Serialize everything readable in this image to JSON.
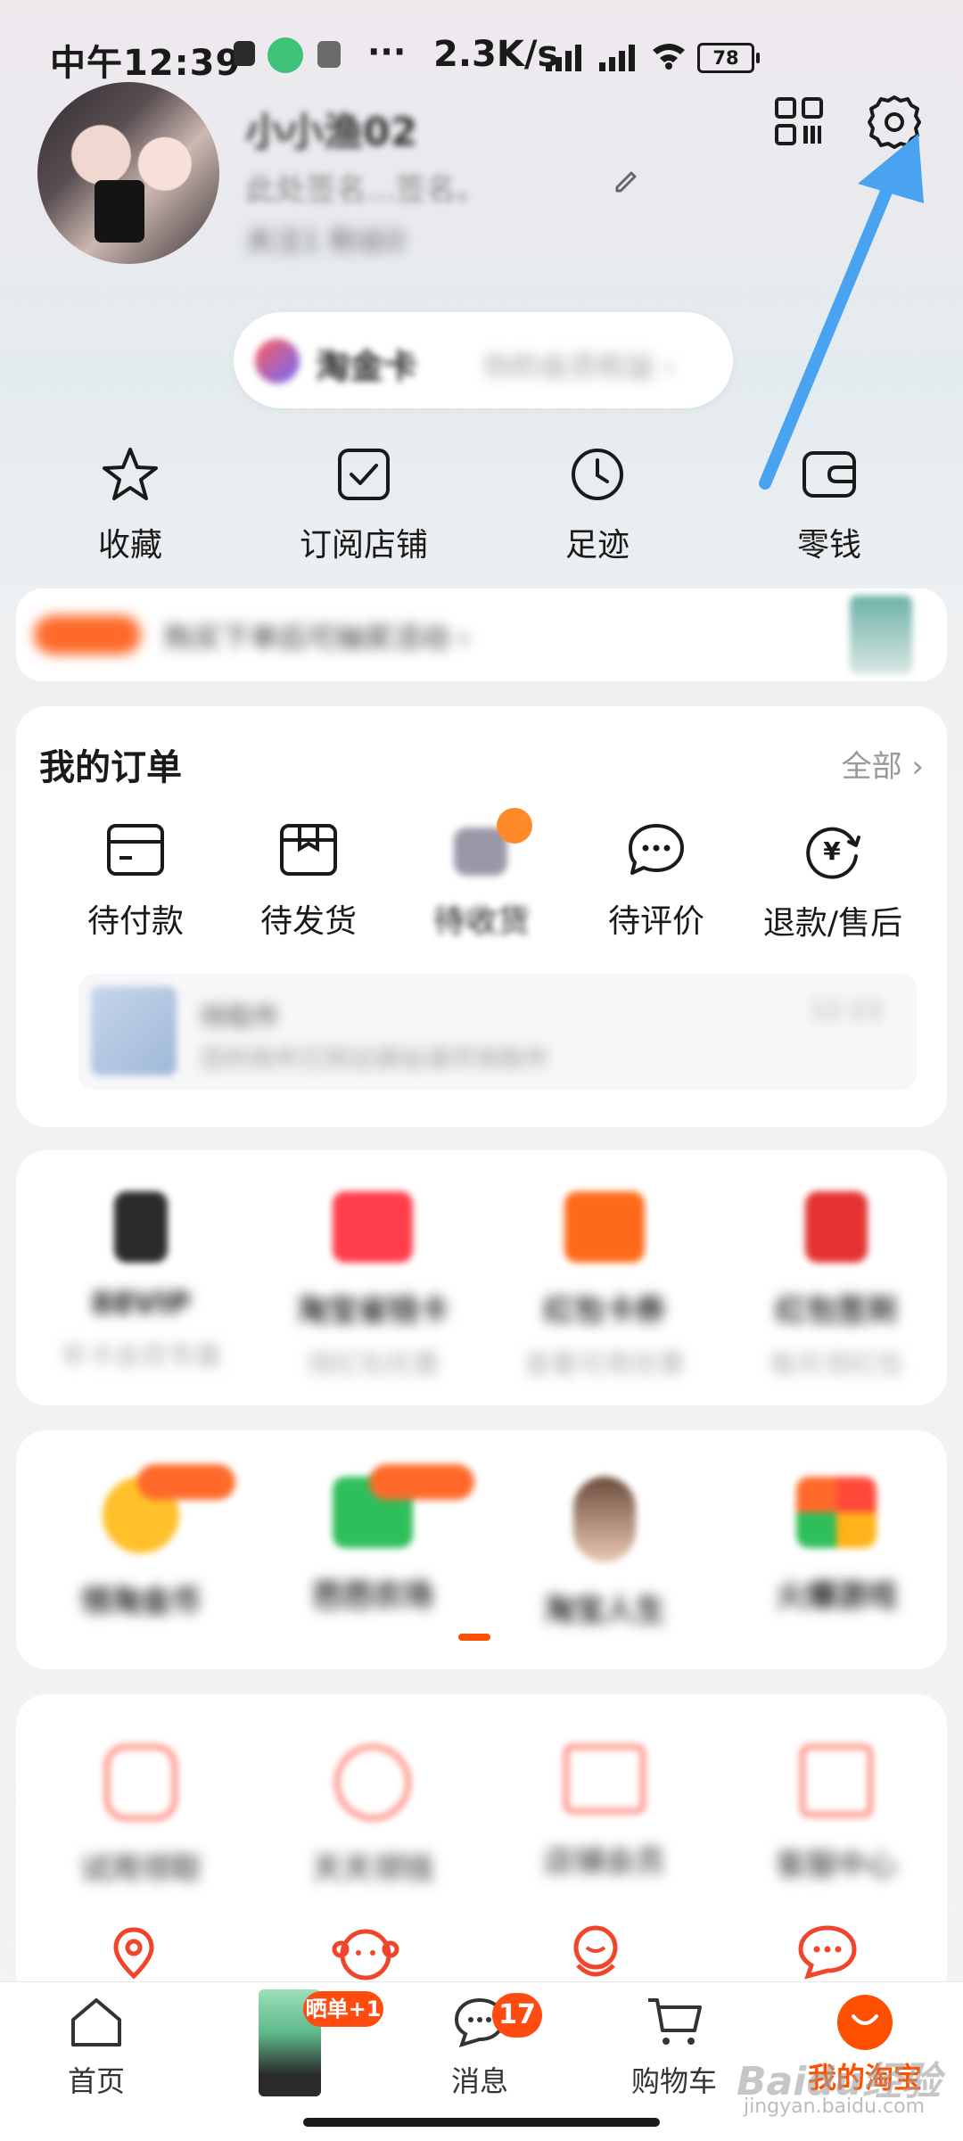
{
  "status_bar": {
    "time": "中午12:39",
    "more": "···",
    "net_speed": "2.3K/s",
    "battery": "78"
  },
  "profile": {
    "username": "小小渔02",
    "signature": "此处签名...签名。",
    "stats": "关注1   粉丝0"
  },
  "member_pill": {
    "name": "淘金卡",
    "desc": "你的会员权益 ›"
  },
  "quick_links": [
    {
      "label": "收藏"
    },
    {
      "label": "订阅店铺"
    },
    {
      "label": "足迹"
    },
    {
      "label": "零钱"
    }
  ],
  "banner": {
    "text": "购买下单后可抽奖活动 ›"
  },
  "orders": {
    "title": "我的订单",
    "all": "全部",
    "items": [
      {
        "label": "待付款"
      },
      {
        "label": "待发货"
      },
      {
        "label": "待收货"
      },
      {
        "label": "待评价"
      },
      {
        "label": "退款/售后"
      }
    ],
    "logistics": {
      "title": "待取件",
      "desc": "您的快件已到达驿站请尽快取件",
      "date": "12-23"
    }
  },
  "services": [
    {
      "t1": "88VIP",
      "t2": "年卡会员专属"
    },
    {
      "t1": "淘宝省钱卡",
      "t2": "领红包优惠"
    },
    {
      "t1": "红包卡券",
      "t2": "查看可用优惠"
    },
    {
      "t1": "红包签到",
      "t2": "每天领红包"
    }
  ],
  "activities": [
    {
      "label": "领淘金币"
    },
    {
      "label": "芭芭农场"
    },
    {
      "label": "淘宝人生"
    },
    {
      "label": "火爆游戏"
    }
  ],
  "tools": [
    {
      "label": "试用领取"
    },
    {
      "label": "天天领钱"
    },
    {
      "label": "店铺会员"
    },
    {
      "label": "客服中心"
    }
  ],
  "nav": {
    "items": [
      {
        "label": "首页"
      },
      {
        "label": ""
      },
      {
        "label": "消息"
      },
      {
        "label": "购物车"
      },
      {
        "label": "我的淘宝"
      }
    ],
    "share_badge": "晒单+1",
    "message_badge": "17"
  },
  "watermark": {
    "brand": "Baidu经验",
    "url": "jingyan.baidu.com"
  },
  "colors": {
    "accent": "#ff5000",
    "arrow": "#4aa3f0"
  }
}
